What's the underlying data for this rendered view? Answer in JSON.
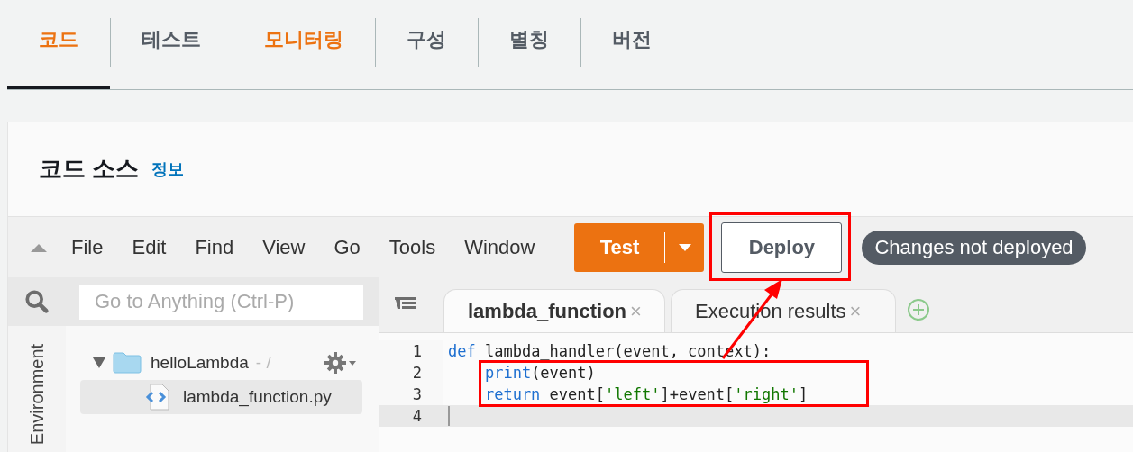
{
  "tabs": [
    {
      "label": "코드",
      "selected": true,
      "emphasized": true
    },
    {
      "label": "테스트",
      "selected": false,
      "emphasized": false
    },
    {
      "label": "모니터링",
      "selected": false,
      "emphasized": true
    },
    {
      "label": "구성",
      "selected": false,
      "emphasized": false
    },
    {
      "label": "별칭",
      "selected": false,
      "emphasized": false
    },
    {
      "label": "버전",
      "selected": false,
      "emphasized": false
    }
  ],
  "section": {
    "title": "코드 소스",
    "info_link": "정보"
  },
  "editor": {
    "menu": [
      "File",
      "Edit",
      "Find",
      "View",
      "Go",
      "Tools",
      "Window"
    ],
    "test_button": "Test",
    "deploy_button": {
      "label": "Deploy",
      "highlighted": true
    },
    "status_badge": "Changes not deployed",
    "sidebar": {
      "search": {
        "placeholder": "Go to Anything (Ctrl-P)"
      },
      "panel_label": "Environment",
      "tree": [
        {
          "label": "helloLambda",
          "suffix": "- /",
          "kind": "folder",
          "expanded": true,
          "children": [
            {
              "label": "lambda_function.py",
              "kind": "file",
              "selected": true
            }
          ]
        }
      ]
    },
    "tabs": [
      {
        "label": "lambda_function",
        "close": "×",
        "selected": true
      },
      {
        "label": "Execution results",
        "close": "×",
        "selected": false
      }
    ],
    "code": [
      {
        "number": "1",
        "current": false,
        "highlighted": false,
        "tokens": [
          {
            "t": "def",
            "kind": "keyword"
          },
          {
            "t": " lambda_handler(event, context):",
            "kind": "plain"
          }
        ]
      },
      {
        "number": "2",
        "current": false,
        "highlighted": true,
        "indented": true,
        "tokens": [
          {
            "t": "print",
            "kind": "keyword"
          },
          {
            "t": "(event)",
            "kind": "plain"
          }
        ]
      },
      {
        "number": "3",
        "current": false,
        "highlighted": true,
        "indented": true,
        "tokens": [
          {
            "t": "return",
            "kind": "keyword"
          },
          {
            "t": " event[",
            "kind": "plain"
          },
          {
            "t": "'left'",
            "kind": "string"
          },
          {
            "t": "]+event[",
            "kind": "plain"
          },
          {
            "t": "'right'",
            "kind": "string"
          },
          {
            "t": "]",
            "kind": "plain"
          }
        ]
      },
      {
        "number": "4",
        "current": true,
        "highlighted": false
      }
    ]
  }
}
